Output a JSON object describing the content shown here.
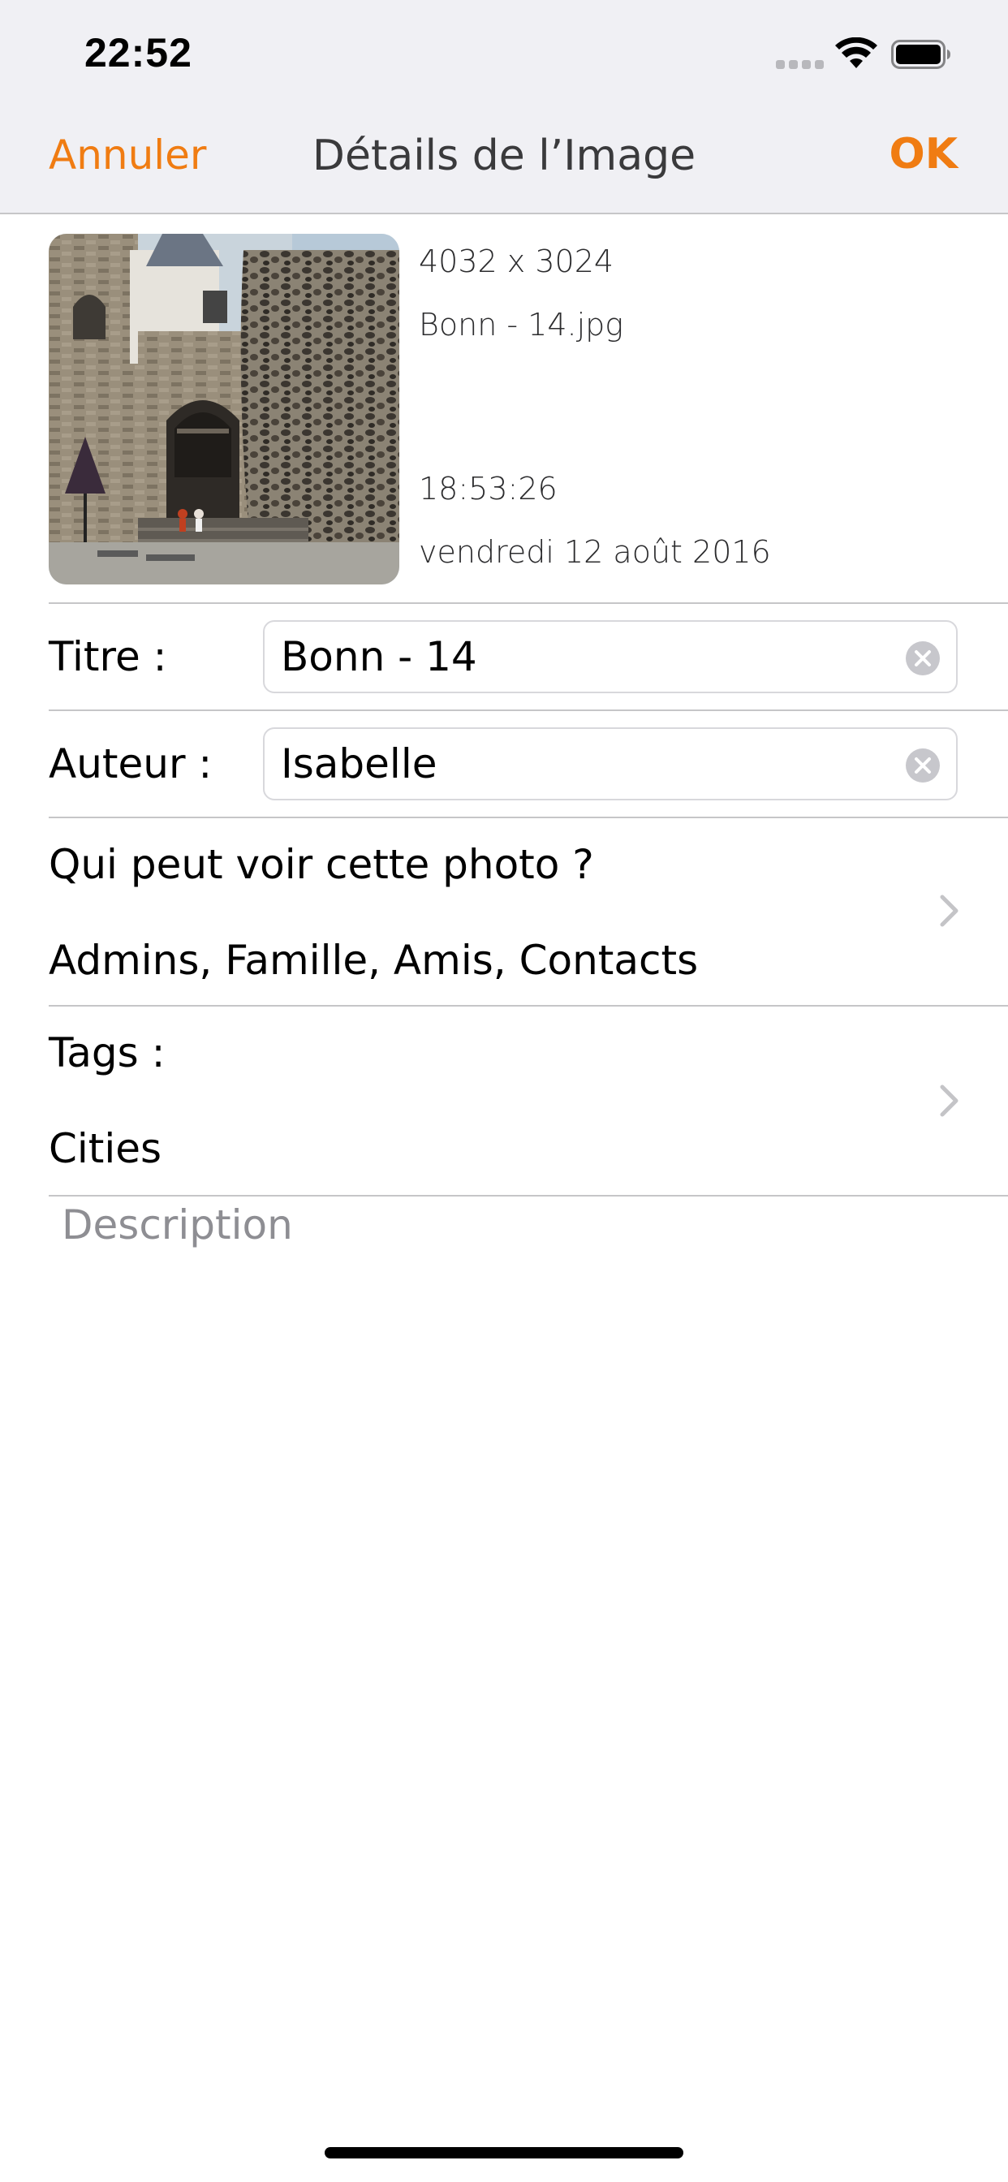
{
  "status_bar": {
    "time": "22:52"
  },
  "nav": {
    "cancel_label": "Annuler",
    "title": "Détails de l’Image",
    "ok_label": "OK",
    "accent_color": "#f07c12"
  },
  "image": {
    "dimensions": "4032 x 3024",
    "filename": "Bonn - 14.jpg",
    "time": "18:53:26",
    "date": "vendredi 12 août 2016"
  },
  "form": {
    "title_label": "Titre :",
    "title_value": "Bonn - 14",
    "author_label": "Auteur :",
    "author_value": "Isabelle",
    "privacy_label": "Qui peut voir cette photo ?",
    "privacy_value": "Admins, Famille, Amis, Contacts",
    "tags_label": "Tags :",
    "tags_value": "Cities",
    "description_placeholder": "Description",
    "description_value": ""
  },
  "icons": {
    "clear": "clear-circle-icon",
    "chevron": "chevron-right-icon",
    "wifi": "wifi-icon",
    "battery": "battery-icon"
  }
}
